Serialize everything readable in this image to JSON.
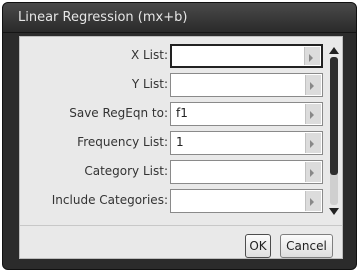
{
  "window": {
    "title": "Linear Regression (mx+b)"
  },
  "fields": [
    {
      "label": "X List:",
      "value": "",
      "focused": true
    },
    {
      "label": "Y List:",
      "value": ""
    },
    {
      "label": "Save RegEqn to:",
      "value": "f1"
    },
    {
      "label": "Frequency List:",
      "value": "1"
    },
    {
      "label": "Category List:",
      "value": ""
    },
    {
      "label": "Include Categories:",
      "value": ""
    }
  ],
  "scrollbar": {
    "visible_fraction": 0.8,
    "position": 0
  },
  "buttons": {
    "ok": "OK",
    "cancel": "Cancel"
  },
  "icons": {
    "dropdown": "chevron-right-icon",
    "scroll_up": "arrow-up-icon",
    "scroll_down": "arrow-down-icon"
  }
}
